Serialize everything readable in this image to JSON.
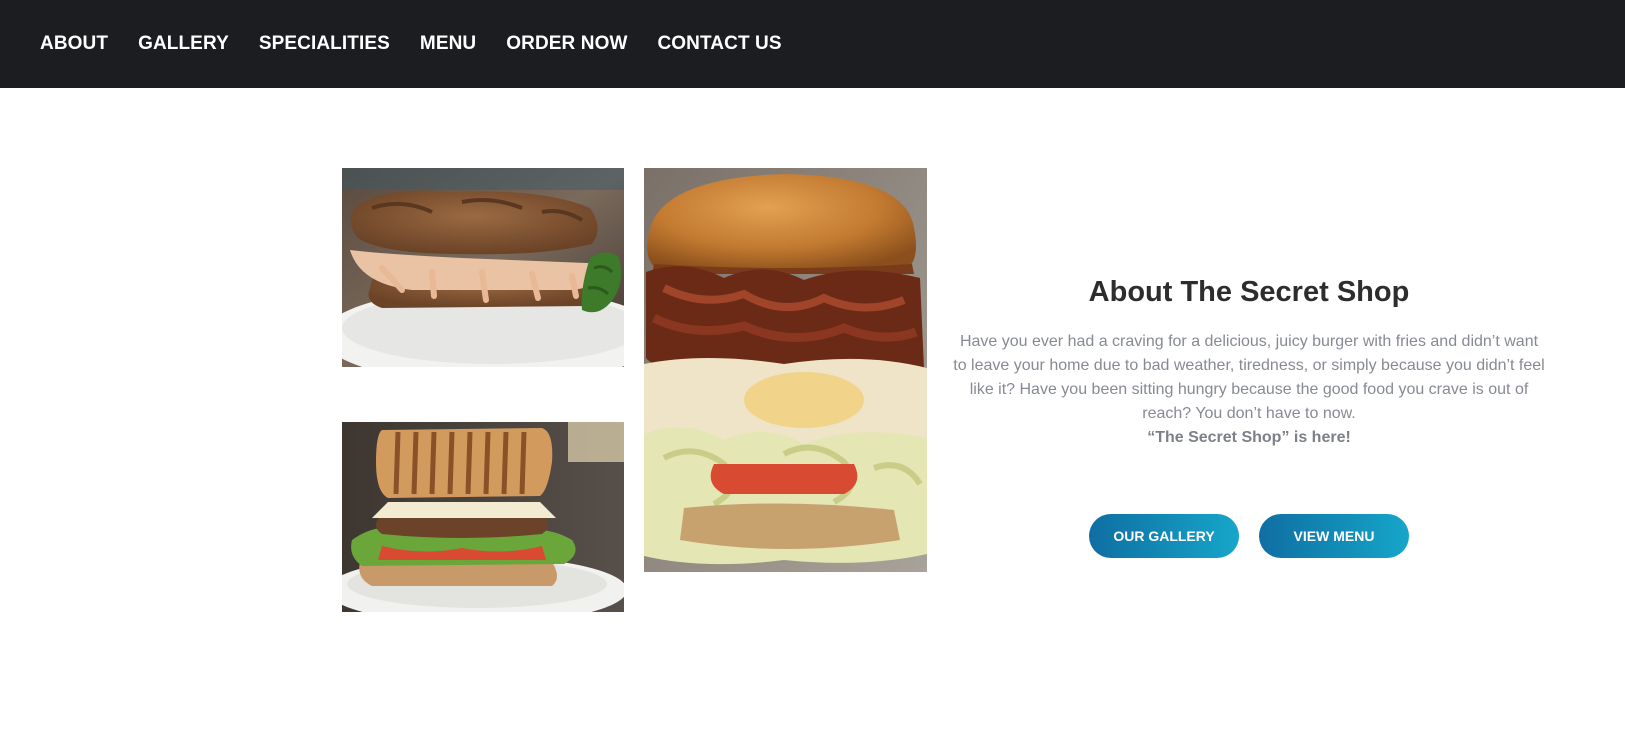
{
  "nav": {
    "items": [
      "ABOUT",
      "GALLERY",
      "SPECIALITIES",
      "MENU",
      "ORDER NOW",
      "CONTACT US"
    ],
    "background_color": "#1c1d21"
  },
  "gallery": {
    "images": [
      {
        "subject": "fried chicken sandwich with sauce on white plate"
      },
      {
        "subject": "grilled panini burger with lettuce and tomato"
      },
      {
        "subject": "tall burger with bacon, fried egg and lettuce"
      }
    ]
  },
  "about": {
    "title": "About The Secret Shop",
    "paragraph": "Have you ever had a craving for a delicious, juicy burger with fries and didn’t want to leave your home due to bad weather, tiredness, or simply because you didn’t feel like it? Have you been sitting hungry because the good food you crave is out of reach? You don’t have to now.",
    "tagline": "“The Secret Shop” is here!"
  },
  "buttons": {
    "gallery_label": "OUR GALLERY",
    "menu_label": "VIEW MENU",
    "gradient_start": "#0f6ea3",
    "gradient_end": "#16a6c9"
  }
}
